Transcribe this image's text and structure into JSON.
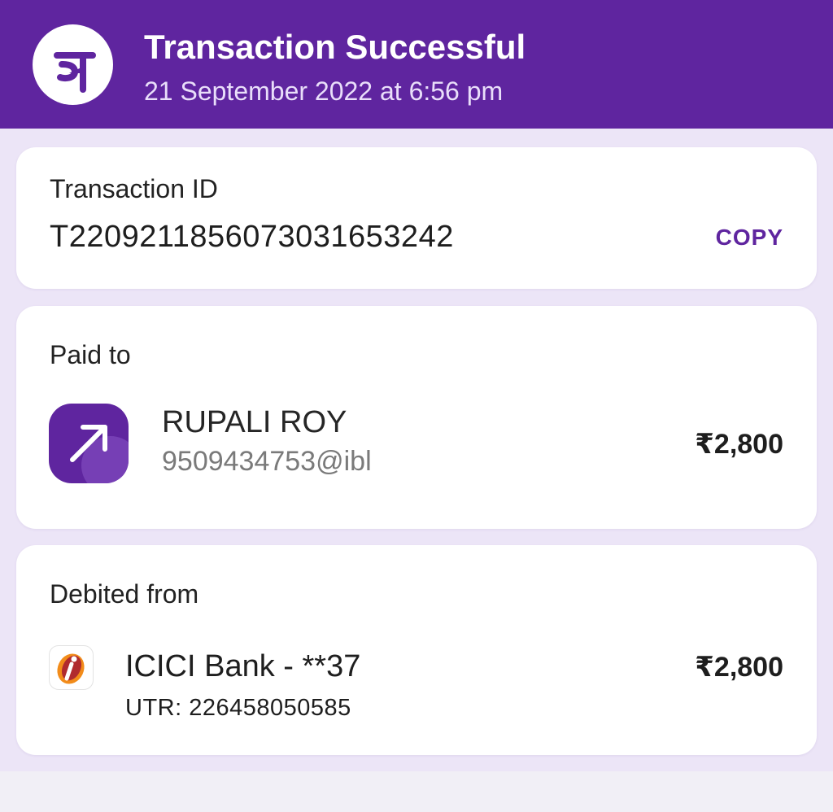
{
  "colors": {
    "brand": "#5f259f",
    "background": "#ece5f7",
    "card": "#ffffff"
  },
  "header": {
    "logo_icon": "phonepe-logo-icon",
    "title": "Transaction Successful",
    "subtitle": "21 September 2022 at 6:56 pm"
  },
  "transaction": {
    "label": "Transaction ID",
    "id": "T2209211856073031653242",
    "copy_label": "COPY"
  },
  "paid_to": {
    "label": "Paid to",
    "avatar_icon": "arrow-up-right-icon",
    "name": "RUPALI ROY",
    "upi_id": "9509434753@ibl",
    "amount": "₹2,800"
  },
  "debited_from": {
    "label": "Debited from",
    "bank_icon": "icici-bank-logo-icon",
    "bank_name": "ICICI Bank - **37",
    "utr": "UTR: 226458050585",
    "amount": "₹2,800"
  }
}
